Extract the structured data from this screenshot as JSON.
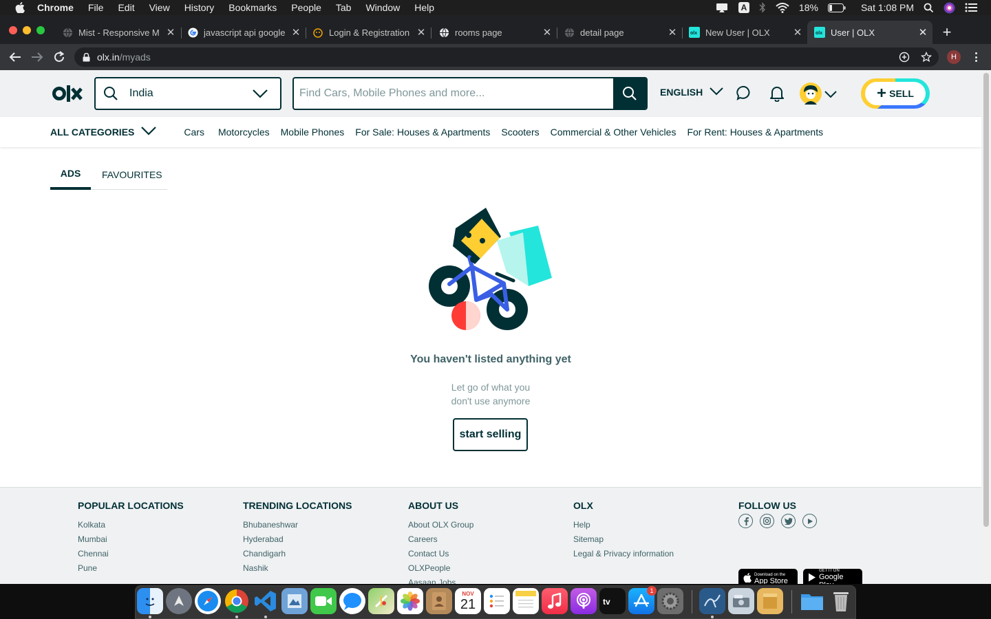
{
  "menubar": {
    "app": "Chrome",
    "items": [
      "File",
      "Edit",
      "View",
      "History",
      "Bookmarks",
      "People",
      "Tab",
      "Window",
      "Help"
    ],
    "battery": "18%",
    "clock": "Sat 1:08 PM",
    "input_source": "A"
  },
  "browser": {
    "tabs": [
      {
        "title": "Mist - Responsive M",
        "icon": "globe-icon"
      },
      {
        "title": "javascript api google",
        "icon": "google-icon"
      },
      {
        "title": "Login & Registration",
        "icon": "face-icon"
      },
      {
        "title": "rooms page",
        "icon": "globe-icon"
      },
      {
        "title": "detail page",
        "icon": "globe-icon"
      },
      {
        "title": "New User | OLX",
        "icon": "olx-icon"
      },
      {
        "title": "User | OLX",
        "icon": "olx-icon"
      }
    ],
    "active_tab": 6,
    "url_host": "olx.in",
    "url_path": "/myads",
    "profile_initial": "H"
  },
  "header": {
    "location": "India",
    "search_placeholder": "Find Cars, Mobile Phones and more...",
    "language": "ENGLISH",
    "sell_label": "SELL"
  },
  "categories": {
    "all_label": "ALL CATEGORIES",
    "items": [
      "Cars",
      "Motorcycles",
      "Mobile Phones",
      "For Sale: Houses & Apartments",
      "Scooters",
      "Commercial & Other Vehicles",
      "For Rent: Houses & Apartments"
    ]
  },
  "tabs": {
    "ads": "ADS",
    "favourites": "FAVOURITES"
  },
  "empty_state": {
    "title": "You haven't listed anything yet",
    "subtitle_line1": "Let go of what you",
    "subtitle_line2": "don't use anymore",
    "button": "start selling"
  },
  "footer": {
    "columns": [
      {
        "heading": "POPULAR LOCATIONS",
        "links": [
          "Kolkata",
          "Mumbai",
          "Chennai",
          "Pune"
        ]
      },
      {
        "heading": "TRENDING LOCATIONS",
        "links": [
          "Bhubaneshwar",
          "Hyderabad",
          "Chandigarh",
          "Nashik"
        ]
      },
      {
        "heading": "ABOUT US",
        "links": [
          "About OLX Group",
          "Careers",
          "Contact Us",
          "OLXPeople",
          "Aasaan Jobs"
        ]
      },
      {
        "heading": "OLX",
        "links": [
          "Help",
          "Sitemap",
          "Legal & Privacy information"
        ]
      }
    ],
    "follow_heading": "FOLLOW US",
    "social_icons": [
      "facebook-icon",
      "instagram-icon",
      "twitter-icon",
      "youtube-icon"
    ],
    "appstore_small": "Download on the",
    "appstore_big": "App Store",
    "play_small": "GET IT ON",
    "play_big": "Google Play"
  },
  "dock": {
    "calendar_month": "NOV",
    "calendar_day": "21",
    "appstore_badge": "1",
    "apps": [
      "finder",
      "launchpad",
      "safari",
      "chrome",
      "vscode",
      "preview",
      "facetime",
      "messages",
      "maps",
      "photos",
      "contacts",
      "calendar",
      "reminders",
      "notes",
      "music",
      "podcasts",
      "tv",
      "app-store",
      "system-preferences",
      "mysql-workbench",
      "image-capture",
      "archive",
      "downloads",
      "trash"
    ]
  },
  "colors": {
    "olx_dark": "#002f34",
    "accent_teal": "#23e5db",
    "accent_blue": "#3a77ff",
    "accent_yellow": "#ffce32"
  }
}
